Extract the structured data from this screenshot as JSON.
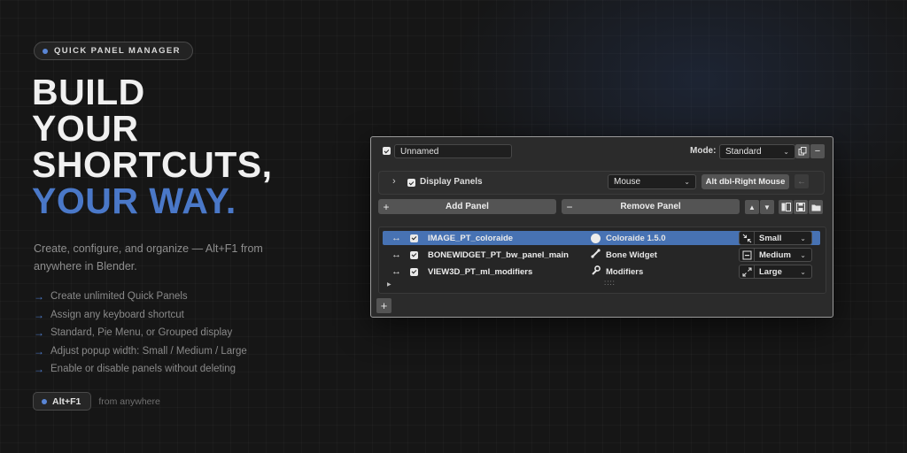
{
  "hero": {
    "badge": "QUICK PANEL MANAGER",
    "headline": [
      "BUILD",
      "YOUR",
      "SHORTCUTS,"
    ],
    "headline_accent": "YOUR WAY.",
    "subtitle": "Create, configure, and organize — Alt+F1 from anywhere in Blender.",
    "features": [
      "Create unlimited Quick Panels",
      "Assign any keyboard shortcut",
      "Standard, Pie Menu, or Grouped display",
      "Adjust popup width: Small / Medium / Large",
      "Enable or disable panels without deleting"
    ],
    "shortcut": "Alt+F1",
    "shortcut_note": "from anywhere",
    "arrow_glyph": "→"
  },
  "panel": {
    "name_value": "Unnamed",
    "mode_label": "Mode:",
    "mode_value": "Standard",
    "display_panels_label": "Display Panels",
    "trigger_value": "Mouse",
    "key_label": "Alt dbl-Right Mouse",
    "add_label": "Add Panel",
    "remove_label": "Remove Panel",
    "rows": [
      {
        "id": "IMAGE_PT_coloraide",
        "desc": "Coloraide 1.5.0",
        "size": "Small",
        "icon": "circle-icon",
        "selected": true
      },
      {
        "id": "BONEWIDGET_PT_bw_panel_main",
        "desc": "Bone Widget",
        "size": "Medium",
        "icon": "bone-icon",
        "selected": false
      },
      {
        "id": "VIEW3D_PT_ml_modifiers",
        "desc": "Modifiers",
        "size": "Large",
        "icon": "wrench-icon",
        "selected": false
      }
    ]
  },
  "colors": {
    "accent": "#4a78c8",
    "selected_row": "#4772b3",
    "panel_bg": "#2b2b2b"
  }
}
